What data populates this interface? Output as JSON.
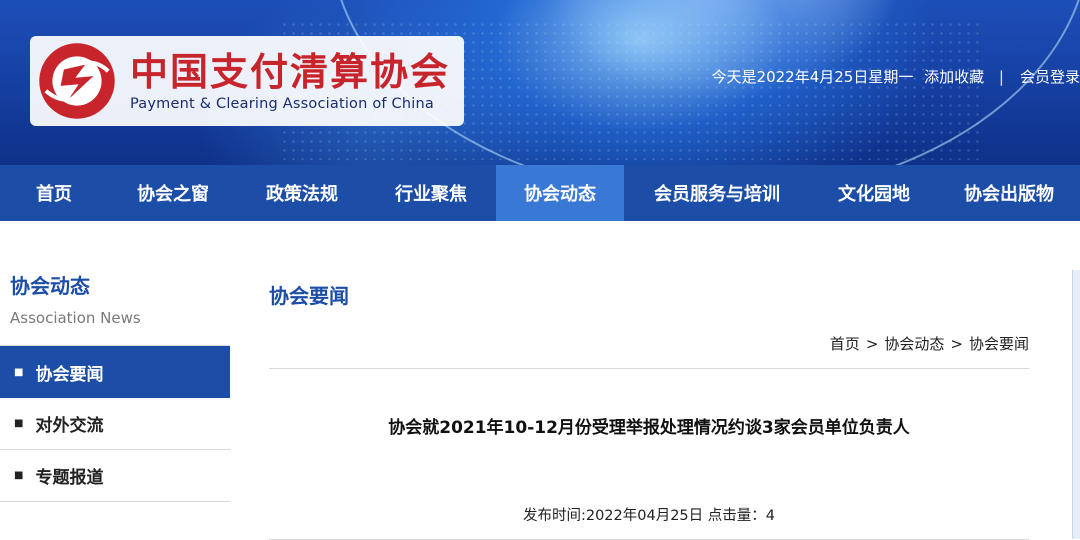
{
  "header": {
    "org_name_cn": "中国支付清算协会",
    "org_name_en": "Payment & Clearing Association of China",
    "today_text": "今天是2022年4月25日星期一",
    "add_favorite": "添加收藏",
    "separator": "|",
    "member_login": "会员登录"
  },
  "nav": {
    "items": [
      {
        "label": "首页",
        "width": 108
      },
      {
        "label": "协会之窗",
        "width": 130
      },
      {
        "label": "政策法规",
        "width": 128
      },
      {
        "label": "行业聚焦",
        "width": 130
      },
      {
        "label": "协会动态",
        "width": 128
      },
      {
        "label": "会员服务与培训",
        "width": 186
      },
      {
        "label": "文化园地",
        "width": 128
      },
      {
        "label": "协会出版物",
        "width": 142
      }
    ],
    "active_index": 4
  },
  "sidebar": {
    "title": "协会动态",
    "subtitle": "Association News",
    "items": [
      {
        "label": "协会要闻",
        "bullet": "■"
      },
      {
        "label": "对外交流",
        "bullet": "■"
      },
      {
        "label": "专题报道",
        "bullet": "■"
      }
    ],
    "active_index": 0
  },
  "main": {
    "section_title": "协会要闻",
    "breadcrumb": [
      "首页",
      "协会动态",
      "协会要闻"
    ],
    "breadcrumb_sep": ">",
    "article_title": "协会就2021年10-12月份受理举报处理情况约谈3家会员单位负责人",
    "publish_label": "发布时间:",
    "publish_date": "2022年04月25日",
    "clicks_label": "点击量：",
    "clicks_value": "4"
  },
  "colors": {
    "brand_blue": "#1c4ea8",
    "nav_active": "#3a78d6",
    "logo_red": "#c8242b"
  }
}
